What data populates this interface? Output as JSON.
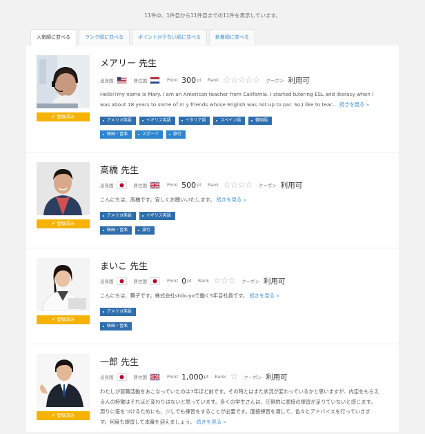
{
  "summary": "11件中、1件目から11件目までの11件を表示しています。",
  "tabs": [
    {
      "label": "人気順に並べる",
      "active": true
    },
    {
      "label": "ランク順に並べる",
      "active": false
    },
    {
      "label": "ポイントが少ない順に並べる",
      "active": false
    },
    {
      "label": "新着順に並べる",
      "active": false
    }
  ],
  "labels": {
    "origin": "出身国",
    "residence": "居住国",
    "point": "Point",
    "unit": "pt",
    "rank": "Rank",
    "coupon": "クーポン",
    "registered": "登録済み",
    "check_icon": "✔"
  },
  "teachers": [
    {
      "name": "メアリー 先生",
      "origin_flag": "usa-flag",
      "residence_flag": "netherlands-flag",
      "points": "300",
      "stars": "☆☆☆☆☆",
      "coupon_status": "利用可",
      "description": "Hello!!my name is Mary. I am an American teacher from California. I started tutoring ESL and literacy when I was about 18 years to some of m y  friends whose English was not up to par. So,I like to teac…",
      "more": "続きを見る »",
      "tags_row1": [
        "アメリカ英語",
        "イギリス英語",
        "イタリア語",
        "スペイン語",
        "韓国語"
      ],
      "tags_row2": [
        "映画・音楽",
        "スポーツ",
        "旅行"
      ]
    },
    {
      "name": "高橋 先生",
      "origin_flag": "japan-flag",
      "residence_flag": "uk-flag",
      "points": "500",
      "stars": "☆☆☆☆",
      "coupon_status": "利用可",
      "description": "こんにちは、高橋です。宜しくお願いいたします。",
      "more": "続きを見る »",
      "tags_row1": [
        "アメリカ英語",
        "イギリス英語"
      ],
      "tags_row2": [
        "映画・音楽",
        "旅行"
      ]
    },
    {
      "name": "まいこ 先生",
      "origin_flag": "japan-flag",
      "residence_flag": "japan-flag",
      "points": "0",
      "stars": "☆☆☆",
      "coupon_status": "利用可",
      "description": "こんにちは、舞子です。株式会社shibuyaで働く5年目社員です。",
      "more": "続きを見る »",
      "tags_row1": [
        "アメリカ英語"
      ],
      "tags_row2": [
        "映画・音楽"
      ]
    },
    {
      "name": "一郎 先生",
      "origin_flag": "japan-flag",
      "residence_flag": "uk-flag",
      "points": "1,000",
      "stars": "☆",
      "coupon_status": "利用可",
      "description": "わたしが就職活動をおこなっていたのは7年ほど前です。その時とはまた状況が変わっているかと思いますが、内定をもらえる人の特徴はそれほど変わりはないと思っています。多くの学生さんは、圧倒的に面接の練習が足りていないと感じます。周りに差をつけるためにも、少しでも練習をすることが必要です。面接練習を通して、色々とアドバイスを行っていきます。何度も練習して本番を迎えましょう。",
      "more": "続きを見る »",
      "tags_row1": [],
      "tags_row2": []
    }
  ],
  "colors": {
    "accent": "#3a8fd6",
    "badge": "#f5b300",
    "tag": "#2f6fae"
  }
}
